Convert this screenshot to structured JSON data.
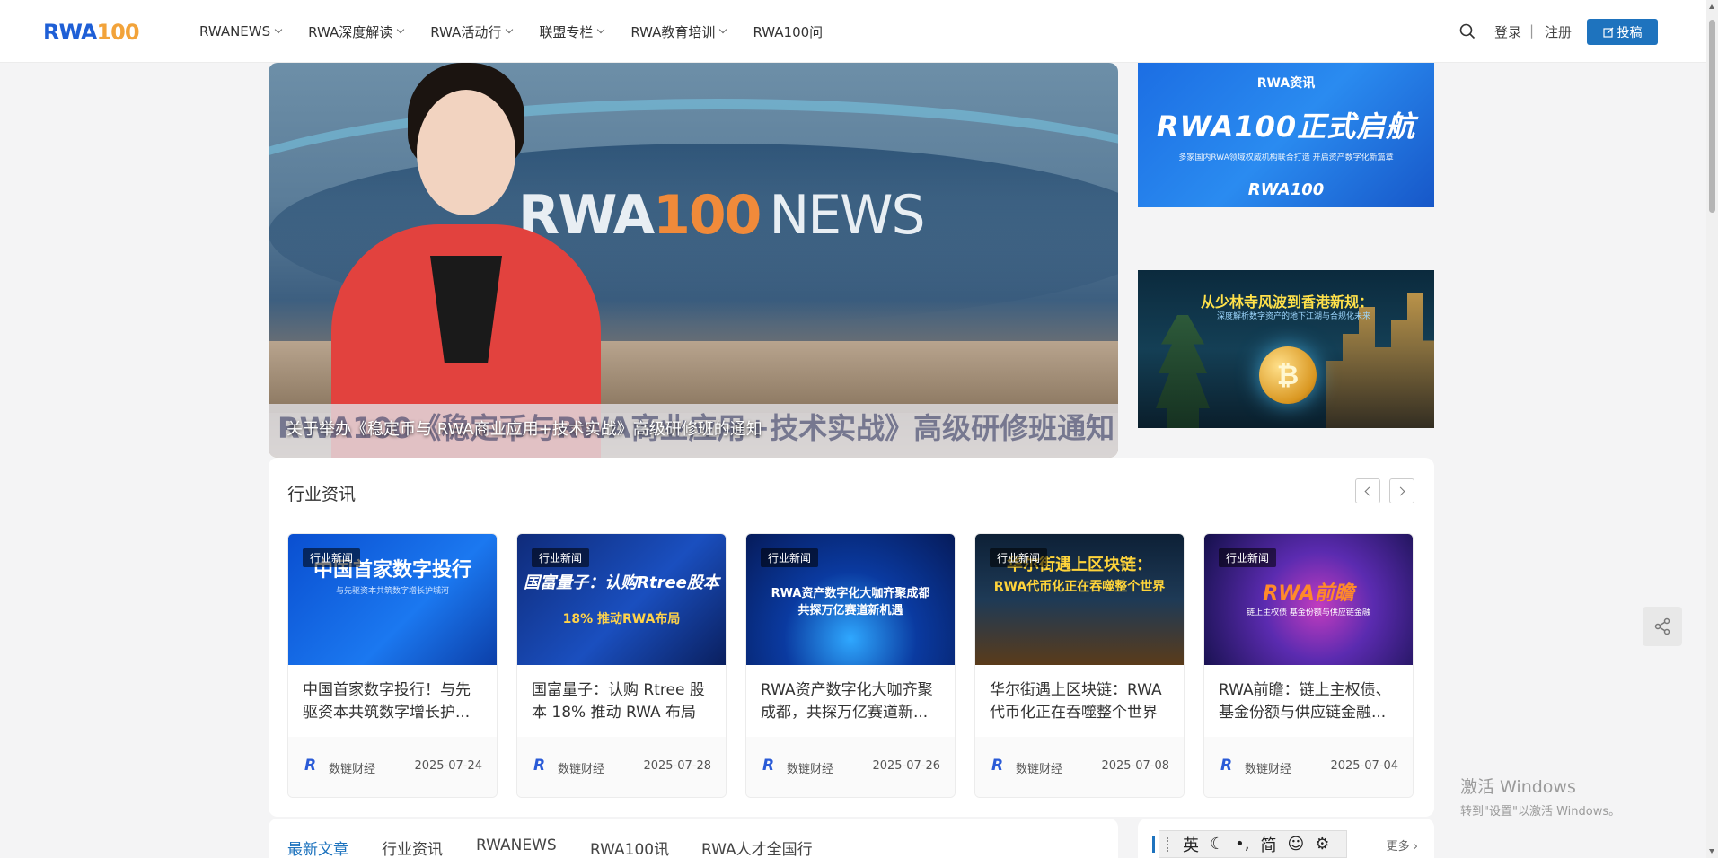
{
  "header": {
    "logo_part1": "RWA",
    "logo_part2": "100",
    "nav": [
      {
        "label": "RWANEWS"
      },
      {
        "label": "RWA深度解读"
      },
      {
        "label": "RWA活动行"
      },
      {
        "label": "联盟专栏"
      },
      {
        "label": "RWA教育培训"
      },
      {
        "label": "RWA100问"
      }
    ],
    "login": "登录",
    "separator": "|",
    "register": "注册",
    "contribute": "投稿"
  },
  "hero": {
    "news_logo_a": "RWA",
    "news_logo_b": "100",
    "news_logo_c": "NEWS",
    "ticker_text": "RWA100《稳定币与RWA商业应用+技术实战》高级研修班通知",
    "caption": "关于举办《稳定币与 RWA商业应用+技术实战》高级研修班的通知"
  },
  "banners": {
    "banner1": {
      "line1": "RWA资讯",
      "line2": "RWA100正式启航",
      "line3": "多家国内RWA领域权威机构联合打造 开启资产数字化新篇章",
      "line4": "RWA100"
    },
    "banner2": {
      "line1": "从少林寺风波到香港新规：",
      "line2": "深度解析数字资产的地下江湖与合规化未来",
      "coin_symbol": "₿"
    }
  },
  "industry_news": {
    "title": "行业资讯",
    "cards": [
      {
        "tag": "行业新闻",
        "thumb_text": "中国首家数字投行",
        "thumb_sub": "与先驱资本共筑数字增长护城河",
        "title": "中国首家数字投行！与先驱资本共筑数字增长护...",
        "author": "数链财经",
        "date": "2025-07-24"
      },
      {
        "tag": "行业新闻",
        "thumb_text": "国富量子：认购Rtree股本",
        "thumb_sub": "18% 推动RWA布局",
        "title": "国富量子：认购 Rtree 股本 18% 推动 RWA 布局",
        "author": "数链财经",
        "date": "2025-07-28"
      },
      {
        "tag": "行业新闻",
        "thumb_text": "RWA资产数字化大咖齐聚成都",
        "thumb_sub": "共探万亿赛道新机遇",
        "title": "RWA资产数字化大咖齐聚成都，共探万亿赛道新...",
        "author": "数链财经",
        "date": "2025-07-26"
      },
      {
        "tag": "行业新闻",
        "thumb_text": "华尔街遇上区块链：",
        "thumb_sub": "RWA代币化正在吞噬整个世界",
        "title": "华尔街遇上区块链：RWA代币化正在吞噬整个世界",
        "author": "数链财经",
        "date": "2025-07-08"
      },
      {
        "tag": "行业新闻",
        "thumb_text": "RWA前瞻",
        "thumb_sub": "链上主权债 基金份额与供应链金融",
        "title": "RWA前瞻：链上主权债、基金份额与供应链金融...",
        "author": "数链财经",
        "date": "2025-07-04"
      }
    ]
  },
  "bottom_tabs": [
    {
      "label": "最新文章",
      "active": true
    },
    {
      "label": "行业资讯"
    },
    {
      "label": "RWANEWS"
    },
    {
      "label": "RWA100讯"
    },
    {
      "label": "RWA人才全国行"
    }
  ],
  "right_box": {
    "more": "更多"
  },
  "ime": {
    "items": [
      "英",
      "☾",
      "•,",
      "简",
      "☺",
      "⚙"
    ]
  },
  "windows": {
    "line1": "激活 Windows",
    "line2": "转到\"设置\"以激活 Windows。"
  },
  "colors": {
    "accent": "#1e73be",
    "logo_blue": "#1e5fd6",
    "logo_orange": "#f2a33a"
  }
}
